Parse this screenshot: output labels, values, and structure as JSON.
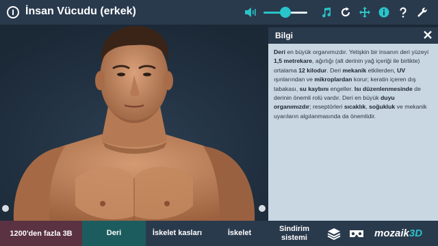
{
  "app": {
    "title": "İnsan Vücudu (erkek)"
  },
  "toolbar": {
    "volume_level": 0.62,
    "accent_color": "#29c4c9",
    "icons": [
      "info-icon",
      "volume-icon",
      "music-icon",
      "reset-icon",
      "move-icon",
      "info-filled-icon",
      "help-icon",
      "settings-icon"
    ]
  },
  "panel": {
    "title": "Bilgi",
    "paragraph": [
      {
        "t": "Deri",
        "b": true
      },
      {
        "t": " en büyük organımızdır. Yetişkin bir insanın deri yüzeyi ",
        "b": false
      },
      {
        "t": "1,5 metrekare",
        "b": true
      },
      {
        "t": ", ağırlığı (alt derinin yağ içeriği ile birlikte) ortalama ",
        "b": false
      },
      {
        "t": "12 kilodur",
        "b": true
      },
      {
        "t": ". Deri ",
        "b": false
      },
      {
        "t": "mekanik",
        "b": true
      },
      {
        "t": " etkilerden, ",
        "b": false
      },
      {
        "t": "UV",
        "b": true
      },
      {
        "t": " ışınlarından ve ",
        "b": false
      },
      {
        "t": "mikroplardan",
        "b": true
      },
      {
        "t": " korur; keratin içeren dış tabakası, ",
        "b": false
      },
      {
        "t": "su kaybını",
        "b": true
      },
      {
        "t": " engeller. ",
        "b": false
      },
      {
        "t": "Isı düzenlenmesinde",
        "b": true
      },
      {
        "t": " de derinin önemli rolü vardır. Deri en büyük ",
        "b": false
      },
      {
        "t": "duyu organımızdır",
        "b": true
      },
      {
        "t": "; reseptörleri ",
        "b": false
      },
      {
        "t": "sıcaklık",
        "b": true
      },
      {
        "t": ", ",
        "b": false
      },
      {
        "t": "soğukluk",
        "b": true
      },
      {
        "t": " ve mekanik uyarıların algılanmasında da önemlidir.",
        "b": false
      }
    ]
  },
  "bottom": {
    "count_label": "1200'den fazla 3B",
    "tabs": [
      {
        "label": "Deri",
        "active": true
      },
      {
        "label": "İskelet kasları",
        "active": false
      },
      {
        "label": "İskelet",
        "active": false
      },
      {
        "label": "Sindirim sistemi",
        "active": false
      }
    ],
    "logo_main": "mozaik",
    "logo_accent": "3D"
  }
}
